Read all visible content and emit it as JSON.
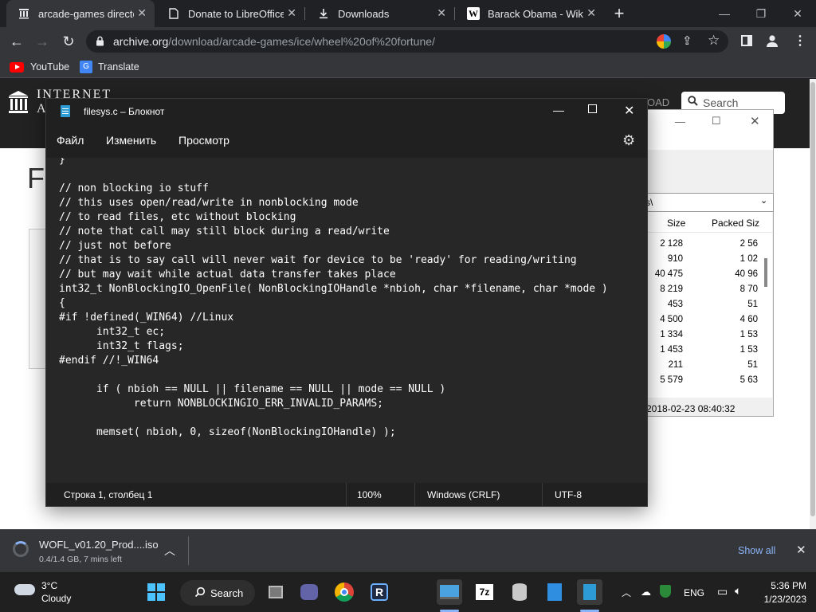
{
  "browser": {
    "tabs": [
      {
        "label": "arcade-games director",
        "icon": "archive-icon",
        "active": true
      },
      {
        "label": "Donate to LibreOffice |",
        "icon": "page-icon",
        "active": false
      },
      {
        "label": "Downloads",
        "icon": "download-icon",
        "active": false
      },
      {
        "label": "Barack Obama - Wikip",
        "icon": "wikipedia-icon",
        "active": false
      }
    ],
    "new_tab_label": "+",
    "url_host": "archive.org",
    "url_path": "/download/arcade-games/ice/wheel%20of%20fortune/",
    "bookmarks": [
      {
        "label": "YouTube",
        "icon": "youtube-icon"
      },
      {
        "label": "Translate",
        "icon": "translate-icon"
      }
    ]
  },
  "archive_page": {
    "logo_line1": "INTERNET",
    "logo_line2": "A",
    "upload_fragment": "OAD",
    "search_placeholder": "Search",
    "page_heading_fragment": "F"
  },
  "zip_window": {
    "path_fragment": "s\\",
    "columns": [
      "Size",
      "Packed Siz"
    ],
    "rows": [
      {
        "size": "2 128",
        "packed": "2 56"
      },
      {
        "size": "910",
        "packed": "1 02"
      },
      {
        "size": "40 475",
        "packed": "40 96"
      },
      {
        "size": "8 219",
        "packed": "8 70"
      },
      {
        "size": "453",
        "packed": "51"
      },
      {
        "size": "4 500",
        "packed": "4 60"
      },
      {
        "size": "1 334",
        "packed": "1 53"
      },
      {
        "size": "1 453",
        "packed": "1 53"
      },
      {
        "size": "211",
        "packed": "51"
      },
      {
        "size": "5 579",
        "packed": "5 63"
      }
    ],
    "status_date": "2018-02-23 08:40:32"
  },
  "notepad": {
    "title": "filesys.c – Блокнот",
    "menu": [
      "Файл",
      "Изменить",
      "Просмотр"
    ],
    "code_lines": [
      "}",
      "",
      "// non blocking io stuff",
      "// this uses open/read/write in nonblocking mode",
      "// to read files, etc without blocking",
      "// note that call may still block during a read/write",
      "// just not before",
      "// that is to say call will never wait for device to be 'ready' for reading/writing",
      "// but may wait while actual data transfer takes place",
      "int32_t NonBlockingIO_OpenFile( NonBlockingIOHandle *nbioh, char *filename, char *mode )",
      "{",
      "#if !defined(_WIN64) //Linux",
      "      int32_t ec;",
      "      int32_t flags;",
      "#endif //!_WIN64",
      "",
      "      if ( nbioh == NULL || filename == NULL || mode == NULL )",
      "            return NONBLOCKINGIO_ERR_INVALID_PARAMS;",
      "",
      "      memset( nbioh, 0, sizeof(NonBlockingIOHandle) );"
    ],
    "status": {
      "position": "Строка 1, столбец 1",
      "zoom": "100%",
      "line_ending": "Windows (CRLF)",
      "encoding": "UTF-8"
    }
  },
  "download_bar": {
    "filename": "WOFL_v01.20_Prod....iso",
    "progress_text": "0.4/1.4 GB, 7 mins left",
    "show_all": "Show all"
  },
  "taskbar": {
    "weather_temp": "3°C",
    "weather_desc": "Cloudy",
    "search_label": "Search",
    "lang": "ENG",
    "time": "5:36 PM",
    "date": "1/23/2023"
  },
  "colors": {
    "chrome_dark": "#202124",
    "chrome_toolbar": "#35363a",
    "notepad_bg": "#272727",
    "accent_blue": "#8ab4f8"
  }
}
